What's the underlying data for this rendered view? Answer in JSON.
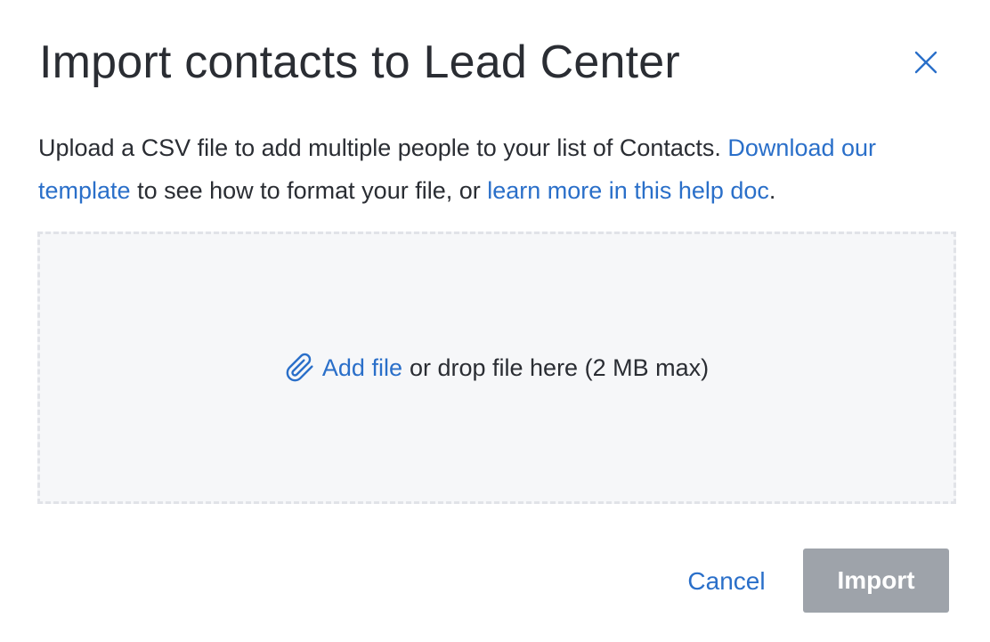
{
  "modal": {
    "title": "Import contacts to Lead Center",
    "close_icon": "close-icon"
  },
  "description": {
    "text_before_link": "Upload a CSV file to add multiple people to your list of Contacts. ",
    "download_link": "Download our template",
    "text_middle": " to see how to format your file, or ",
    "help_link": "learn more in this help doc",
    "text_after": "."
  },
  "dropzone": {
    "icon": "paperclip-icon",
    "add_file_label": "Add file",
    "hint": "or drop file here (2 MB max)"
  },
  "footer": {
    "cancel_label": "Cancel",
    "import_label": "Import",
    "import_disabled": true
  },
  "colors": {
    "link": "#2a6fc9",
    "text": "#2a2d33",
    "dropzone_bg": "#f6f7f9",
    "dropzone_border": "#e1e3e8",
    "import_disabled_bg": "#9ea3aa"
  }
}
